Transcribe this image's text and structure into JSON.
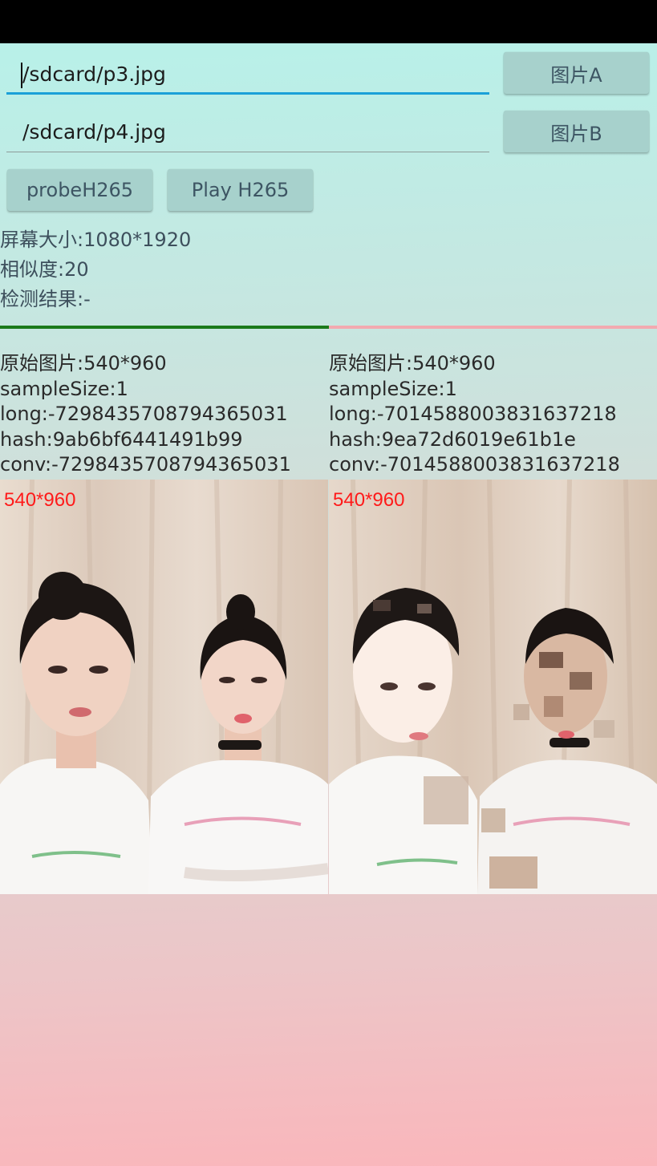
{
  "inputs": {
    "path_a": "/sdcard/p3.jpg",
    "path_b": "/sdcard/p4.jpg"
  },
  "buttons": {
    "pick_a": "图片A",
    "pick_b": "图片B",
    "probe": "probeH265",
    "play": "Play H265"
  },
  "status": {
    "screen_size": "屏幕大小:1080*1920",
    "similarity": "相似度:20",
    "result": "检测结果:-"
  },
  "image_a": {
    "original": "原始图片:540*960",
    "sample_size": "sampleSize:1",
    "long": "long:-7298435708794365031",
    "hash": "hash:9ab6bf6441491b99",
    "conv": "conv:-7298435708794365031",
    "overlay": "540*960"
  },
  "image_b": {
    "original": "原始图片:540*960",
    "sample_size": "sampleSize:1",
    "long": "long:-7014588003831637218",
    "hash": "hash:9ea72d6019e61b1e",
    "conv": "conv:-7014588003831637218",
    "overlay": "540*960"
  },
  "colors": {
    "progress_match": "#1b7a1b",
    "progress_rest": "#f2aab0",
    "overlay_text": "#ff1a1a",
    "focus_underline": "#1aa0d8"
  }
}
